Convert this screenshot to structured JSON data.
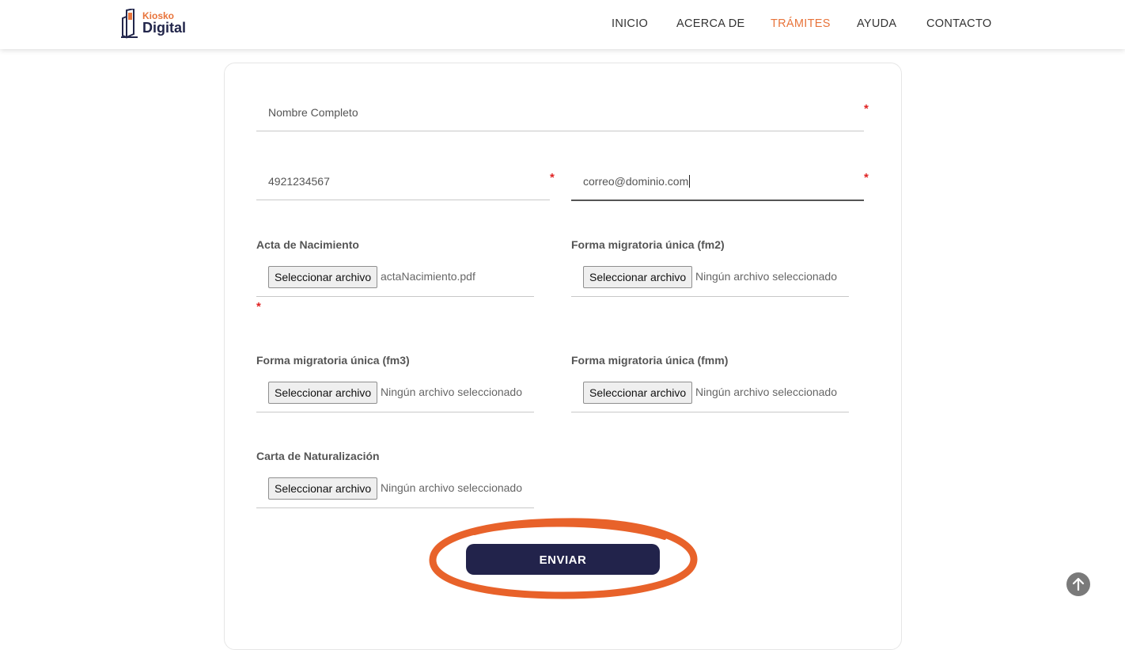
{
  "brand": {
    "top": "Kiosko",
    "bottom": "Digital"
  },
  "nav": {
    "items": [
      "INICIO",
      "ACERCA DE",
      "TRÁMITES",
      "AYUDA",
      "CONTACTO"
    ],
    "active": "TRÁMITES",
    "active_color": "#e8743b"
  },
  "form": {
    "full_name": {
      "placeholder": "Nombre Completo",
      "value": ""
    },
    "phone": {
      "value": "4921234567"
    },
    "email": {
      "value": "correo@dominio.com"
    },
    "required_mark": "*",
    "file_button_label": "Seleccionar archivo",
    "files": [
      {
        "label": "Acta de Nacimiento",
        "file": "actaNacimiento.pdf",
        "required": true
      },
      {
        "label": "Forma migratoria única (fm2)",
        "file": "Ningún archivo seleccionado",
        "required": false
      },
      {
        "label": "Forma migratoria única (fm3)",
        "file": "Ningún archivo seleccionado",
        "required": false
      },
      {
        "label": "Forma migratoria única (fmm)",
        "file": "Ningún archivo seleccionado",
        "required": false
      },
      {
        "label": "Carta de Naturalización",
        "file": "Ningún archivo seleccionado",
        "required": false
      }
    ],
    "submit_label": "ENVIAR"
  },
  "colors": {
    "accent": "#e8743b",
    "primary_button": "#22234b",
    "required": "#e02424"
  },
  "icons": {
    "scroll_top": "arrow-up-icon",
    "logo": "kiosk-icon"
  }
}
